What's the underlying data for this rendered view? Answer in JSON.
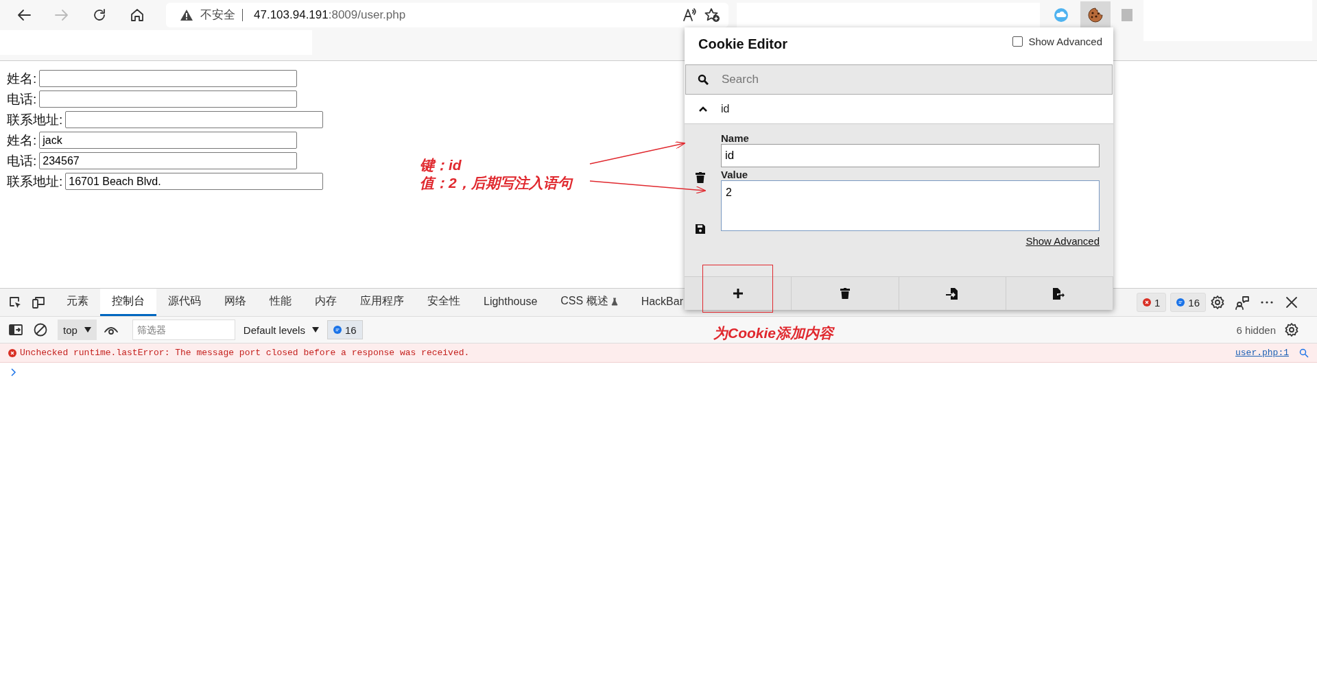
{
  "browser": {
    "back_enabled": true,
    "forward_enabled": false,
    "security_label": "不安全",
    "url_host": "47.103.94.191",
    "url_rest": ":8009/user.php"
  },
  "form": {
    "rows": [
      {
        "label": "姓名:"
      },
      {
        "label": "电话:"
      },
      {
        "label": "联系地址:"
      },
      {
        "label": "姓名:",
        "value": "jack"
      },
      {
        "label": "电话:",
        "value": "234567"
      },
      {
        "label": "联系地址:",
        "value": "16701 Beach Blvd."
      }
    ]
  },
  "annotations": {
    "lines": [
      "键：id",
      "值：2，后期写注入语句"
    ],
    "button_note": "为Cookie添加内容"
  },
  "cookie_editor": {
    "title": "Cookie Editor",
    "show_advanced": {
      "label": "Show Advanced",
      "checked": false
    },
    "search": {
      "placeholder": "Search"
    },
    "cookies": [
      {
        "name": "id",
        "expanded": true,
        "name_label": "Name",
        "name_value": "id",
        "value_label": "Value",
        "value": "2",
        "advanced_link": "Show Advanced"
      }
    ],
    "actions": [
      {
        "kind": "add"
      },
      {
        "kind": "delete"
      },
      {
        "kind": "import"
      },
      {
        "kind": "export"
      }
    ]
  },
  "devtools": {
    "tabs": [
      {
        "label": "元素",
        "selected": false
      },
      {
        "label": "控制台",
        "selected": true
      },
      {
        "label": "源代码",
        "selected": false
      },
      {
        "label": "网络",
        "selected": false
      },
      {
        "label": "性能",
        "selected": false
      },
      {
        "label": "内存",
        "selected": false
      },
      {
        "label": "应用程序",
        "selected": false
      },
      {
        "label": "安全性",
        "selected": false
      },
      {
        "label": "Lighthouse",
        "selected": false
      },
      {
        "label": "CSS 概述",
        "selected": false,
        "experimental": true
      },
      {
        "label": "HackBar",
        "selected": false
      }
    ],
    "error_count": "1",
    "message_count": "16",
    "context": "top",
    "filter_placeholder": "筛选器",
    "levels": "Default levels",
    "levels_badge": "16",
    "hidden": "6 hidden",
    "console": [
      {
        "kind": "error",
        "text": "Unchecked runtime.lastError: The message port closed before a response was received.",
        "source": "user.php:1"
      }
    ]
  }
}
